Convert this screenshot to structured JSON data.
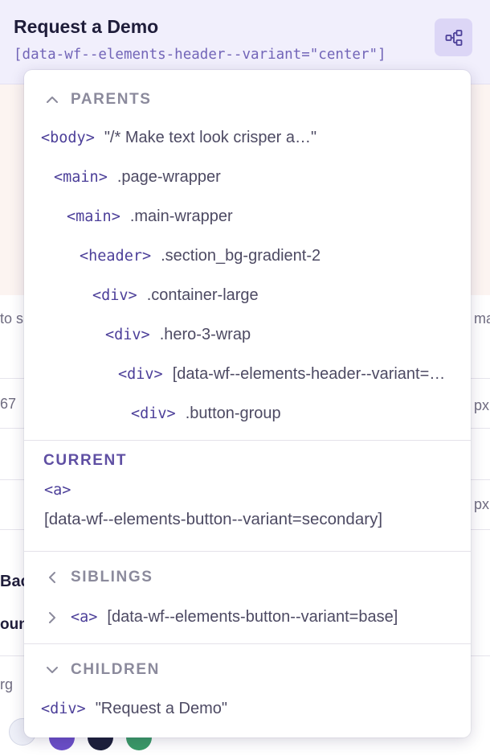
{
  "header": {
    "title": "Request a Demo",
    "subtitle": "[data-wf--elements-header--variant=\"center\"]",
    "navigator_icon": "element-tree-icon"
  },
  "background": {
    "left_fragments": [
      "to s",
      "67",
      "Bac",
      "oun",
      "rg"
    ],
    "right_fragments": [
      "ma",
      "px",
      "px"
    ]
  },
  "popover": {
    "parents": {
      "heading": "PARENTS",
      "icon": "chevron-up-icon",
      "items": [
        {
          "tag": "<body>",
          "selector": "\"/* Make text look crisper a…\""
        },
        {
          "tag": "<main>",
          "selector": ".page-wrapper"
        },
        {
          "tag": "<main>",
          "selector": ".main-wrapper"
        },
        {
          "tag": "<header>",
          "selector": ".section_bg-gradient-2"
        },
        {
          "tag": "<div>",
          "selector": ".container-large"
        },
        {
          "tag": "<div>",
          "selector": ".hero-3-wrap"
        },
        {
          "tag": "<div>",
          "selector": "[data-wf--elements-header--variant=\"center\"]"
        },
        {
          "tag": "<div>",
          "selector": ".button-group"
        }
      ]
    },
    "current": {
      "heading": "CURRENT",
      "tag": "<a>",
      "selector": "[data-wf--elements-button--variant=secondary]"
    },
    "siblings": {
      "heading": "SIBLINGS",
      "icon": "chevron-left-icon",
      "items": [
        {
          "tag": "<a>",
          "selector": "[data-wf--elements-button--variant=base]",
          "icon": "chevron-right-icon"
        }
      ]
    },
    "children": {
      "heading": "CHILDREN",
      "icon": "chevron-down-icon",
      "items": [
        {
          "tag": "<div>",
          "selector": "\"Request a Demo\""
        }
      ]
    }
  },
  "colors": {
    "header_bg": "#f1effc",
    "accent": "#5f4fa3",
    "tag_color": "#4c3f99",
    "peach_bg": "#fcf4f1"
  }
}
